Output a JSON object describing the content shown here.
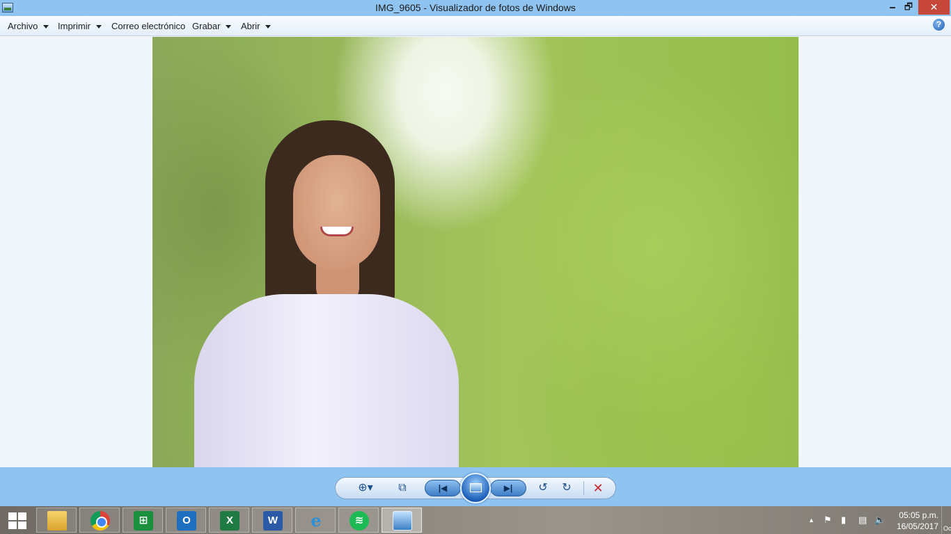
{
  "window": {
    "title": "IMG_9605 - Visualizador de fotos de Windows",
    "minimize_glyph": "🗕",
    "restore_glyph": "🗗",
    "close_glyph": "✕"
  },
  "menu": {
    "items": [
      {
        "label": "Archivo",
        "has_dropdown": true
      },
      {
        "label": "Imprimir",
        "has_dropdown": true
      },
      {
        "label": "Correo electrónico",
        "has_dropdown": false
      },
      {
        "label": "Grabar",
        "has_dropdown": true
      },
      {
        "label": "Abrir",
        "has_dropdown": true
      }
    ],
    "help_glyph": "?"
  },
  "photo": {
    "subject": "portrait-photo",
    "background_colors": [
      "#8aa859",
      "#a3c45a",
      "#95bd4c"
    ]
  },
  "controls": {
    "zoom_icon": "magnifier-zoom-icon",
    "zoom_glyph": "⊕▾",
    "fit_icon": "actual-size-icon",
    "fit_glyph": "⧉",
    "prev_icon": "previous-icon",
    "prev_glyph": "|◀",
    "slideshow_icon": "slideshow-icon",
    "next_icon": "next-icon",
    "next_glyph": "▶|",
    "rotate_left_icon": "rotate-counterclockwise-icon",
    "rotate_left_glyph": "↺",
    "rotate_right_icon": "rotate-clockwise-icon",
    "rotate_right_glyph": "↻",
    "delete_icon": "delete-icon",
    "delete_glyph": "✕",
    "delete_color": "#c8282e"
  },
  "taskbar": {
    "apps": [
      {
        "name": "file-explorer",
        "glyph": ""
      },
      {
        "name": "chrome",
        "glyph": ""
      },
      {
        "name": "windows-store",
        "glyph": "⊞"
      },
      {
        "name": "outlook",
        "glyph": "O"
      },
      {
        "name": "excel",
        "glyph": "X"
      },
      {
        "name": "word",
        "glyph": "W"
      },
      {
        "name": "internet-explorer",
        "glyph": "e"
      },
      {
        "name": "spotify",
        "glyph": "≋"
      },
      {
        "name": "photo-viewer",
        "glyph": ""
      }
    ],
    "tray_glyphs": {
      "overflow": "▲",
      "flag": "⚑",
      "power": "▮",
      "network": "▤",
      "volume": "🔈"
    },
    "time": "05:05 p.m.",
    "date": "16/05/2017",
    "show_desktop_label": "Oo"
  }
}
